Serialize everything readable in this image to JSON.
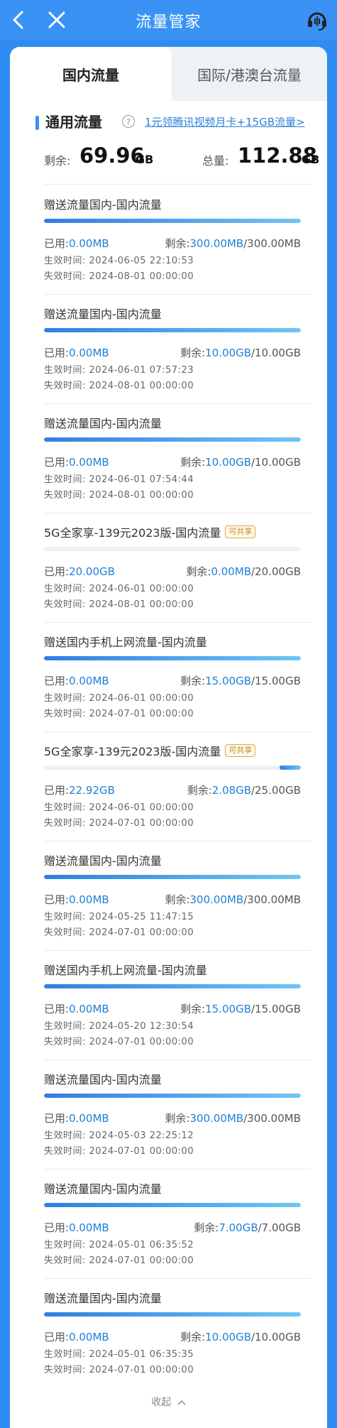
{
  "header": {
    "title": "流量管家"
  },
  "tabs": [
    {
      "label": "国内流量",
      "active": true
    },
    {
      "label": "国际/港澳台流量",
      "active": false
    }
  ],
  "general": {
    "title": "通用流量",
    "promo": "1元领腾讯视频月卡+15GB流量>",
    "remaining_label": "剩余:",
    "remaining_value": "69.96",
    "remaining_unit": "GB",
    "total_label": "总量:",
    "total_value": "112.88",
    "total_unit": "GB"
  },
  "labels": {
    "used": "已用:",
    "remain": "剩余:",
    "start": "生效时间:",
    "end": "失效时间:",
    "shared": "可共享",
    "collapse": "收起"
  },
  "items": [
    {
      "name": "赠送流量国内-国内流量",
      "used": "0.00MB",
      "remain": "300.00MB",
      "total": "/300.00MB",
      "start": "2024-06-05 22:10:53",
      "end": "2024-08-01 00:00:00",
      "remain_fraction": 1.0,
      "shared": false
    },
    {
      "name": "赠送流量国内-国内流量",
      "used": "0.00MB",
      "remain": "10.00GB",
      "total": "/10.00GB",
      "start": "2024-06-01 07:57:23",
      "end": "2024-08-01 00:00:00",
      "remain_fraction": 1.0,
      "shared": false
    },
    {
      "name": "赠送流量国内-国内流量",
      "used": "0.00MB",
      "remain": "10.00GB",
      "total": "/10.00GB",
      "start": "2024-06-01 07:54:44",
      "end": "2024-08-01 00:00:00",
      "remain_fraction": 1.0,
      "shared": false
    },
    {
      "name": "5G全家享-139元2023版-国内流量",
      "used": "20.00GB",
      "remain": "0.00MB",
      "total": "/20.00GB",
      "start": "2024-06-01 00:00:00",
      "end": "2024-08-01 00:00:00",
      "remain_fraction": 0.0,
      "shared": true
    },
    {
      "name": "赠送国内手机上网流量-国内流量",
      "used": "0.00MB",
      "remain": "15.00GB",
      "total": "/15.00GB",
      "start": "2024-06-01 00:00:00",
      "end": "2024-07-01 00:00:00",
      "remain_fraction": 1.0,
      "shared": false
    },
    {
      "name": "5G全家享-139元2023版-国内流量",
      "used": "22.92GB",
      "remain": "2.08GB",
      "total": "/25.00GB",
      "start": "2024-06-01 00:00:00",
      "end": "2024-07-01 00:00:00",
      "remain_fraction": 0.0832,
      "shared": true
    },
    {
      "name": "赠送流量国内-国内流量",
      "used": "0.00MB",
      "remain": "300.00MB",
      "total": "/300.00MB",
      "start": "2024-05-25 11:47:15",
      "end": "2024-07-01 00:00:00",
      "remain_fraction": 1.0,
      "shared": false
    },
    {
      "name": "赠送国内手机上网流量-国内流量",
      "used": "0.00MB",
      "remain": "15.00GB",
      "total": "/15.00GB",
      "start": "2024-05-20 12:30:54",
      "end": "2024-07-01 00:00:00",
      "remain_fraction": 1.0,
      "shared": false
    },
    {
      "name": "赠送流量国内-国内流量",
      "used": "0.00MB",
      "remain": "300.00MB",
      "total": "/300.00MB",
      "start": "2024-05-03 22:25:12",
      "end": "2024-07-01 00:00:00",
      "remain_fraction": 1.0,
      "shared": false
    },
    {
      "name": "赠送流量国内-国内流量",
      "used": "0.00MB",
      "remain": "7.00GB",
      "total": "/7.00GB",
      "start": "2024-05-01 06:35:52",
      "end": "2024-07-01 00:00:00",
      "remain_fraction": 1.0,
      "shared": false
    },
    {
      "name": "赠送流量国内-国内流量",
      "used": "0.00MB",
      "remain": "10.00GB",
      "total": "/10.00GB",
      "start": "2024-05-01 06:35:35",
      "end": "2024-07-01 00:00:00",
      "remain_fraction": 1.0,
      "shared": false
    }
  ]
}
